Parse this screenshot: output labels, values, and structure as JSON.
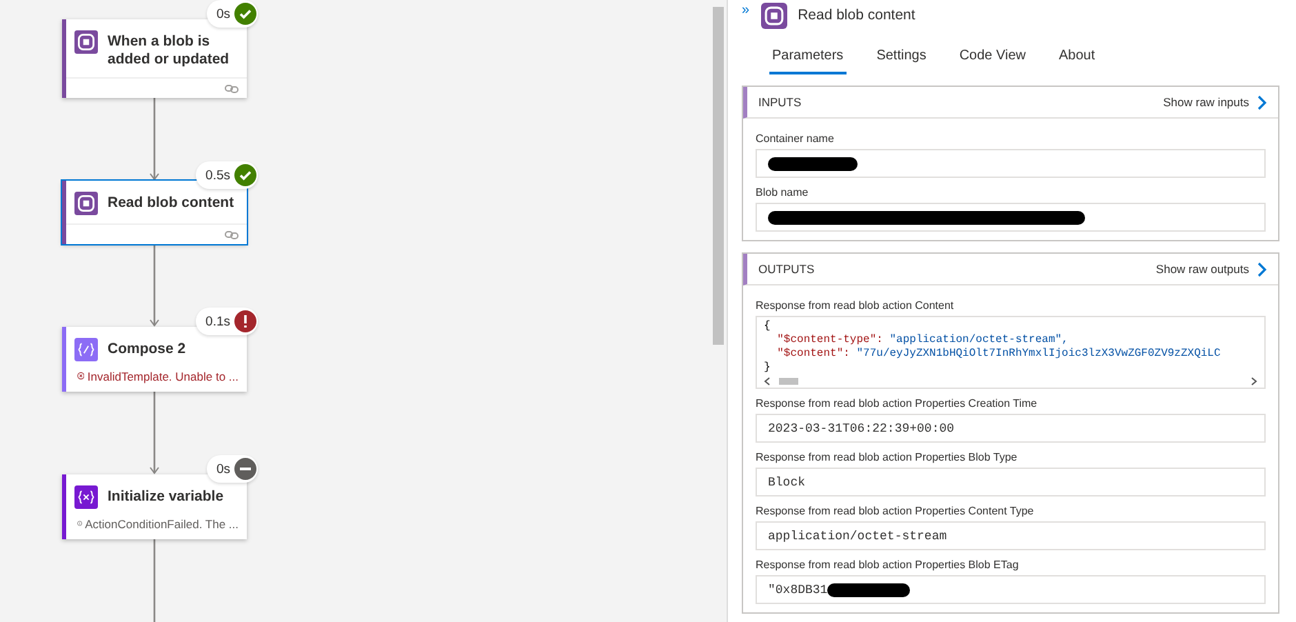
{
  "flow": {
    "steps": [
      {
        "title": "When a blob is added or updated",
        "duration": "0s",
        "kind": "success",
        "color": "#7a4a9e",
        "selected": false,
        "footer": true
      },
      {
        "title": "Read blob content",
        "duration": "0.5s",
        "kind": "success",
        "color": "#7a4a9e",
        "selected": true,
        "footer": true
      },
      {
        "title": "Compose 2",
        "duration": "0.1s",
        "kind": "failed",
        "color": "#8c6cf5",
        "selected": false,
        "message": "InvalidTemplate. Unable to ...",
        "footer": false
      },
      {
        "title": "Initialize variable",
        "duration": "0s",
        "kind": "skipped",
        "color": "#7719d1",
        "selected": false,
        "message": "ActionConditionFailed. The ...",
        "footer": false
      }
    ]
  },
  "panel": {
    "collapse": "»",
    "title": "Read blob content",
    "tabs": [
      {
        "label": "Parameters",
        "selected": true
      },
      {
        "label": "Settings",
        "selected": false
      },
      {
        "label": "Code View",
        "selected": false
      },
      {
        "label": "About",
        "selected": false
      }
    ],
    "sections": [
      {
        "title": "INPUTS",
        "raw_link": "Show raw inputs",
        "fields": [
          {
            "label": "Container name",
            "kind": "text",
            "redacted": true
          },
          {
            "label": "Blob name",
            "kind": "text",
            "redacted": true
          }
        ]
      },
      {
        "title": "OUTPUTS",
        "raw_link": "Show raw outputs",
        "fields": [
          {
            "label": "Response from read blob action Content",
            "kind": "code",
            "open": "{",
            "close": "}",
            "entries": [
              {
                "key": "\"$content-type\":",
                "value": "\"application/octet-stream\","
              },
              {
                "key": "\"$content\":",
                "value": "\"77u/eyJyZXN1bHQiOlt7InRhYmxlIjoic3lzX3VwZGF0ZV9zZXQiLC"
              }
            ]
          },
          {
            "label": "Response from read blob action Properties Creation Time",
            "kind": "text",
            "value": "2023-03-31T06:22:39+00:00",
            "redacted": false
          },
          {
            "label": "Response from read blob action Properties Blob Type",
            "kind": "text",
            "value": "Block",
            "redacted": false
          },
          {
            "label": "Response from read blob action Properties Content Type",
            "kind": "text",
            "value": "application/octet-stream",
            "redacted": false
          },
          {
            "label": "Response from read blob action Properties Blob ETag",
            "kind": "text",
            "value": "\"0x8DB31",
            "redacted": true
          }
        ]
      }
    ]
  }
}
